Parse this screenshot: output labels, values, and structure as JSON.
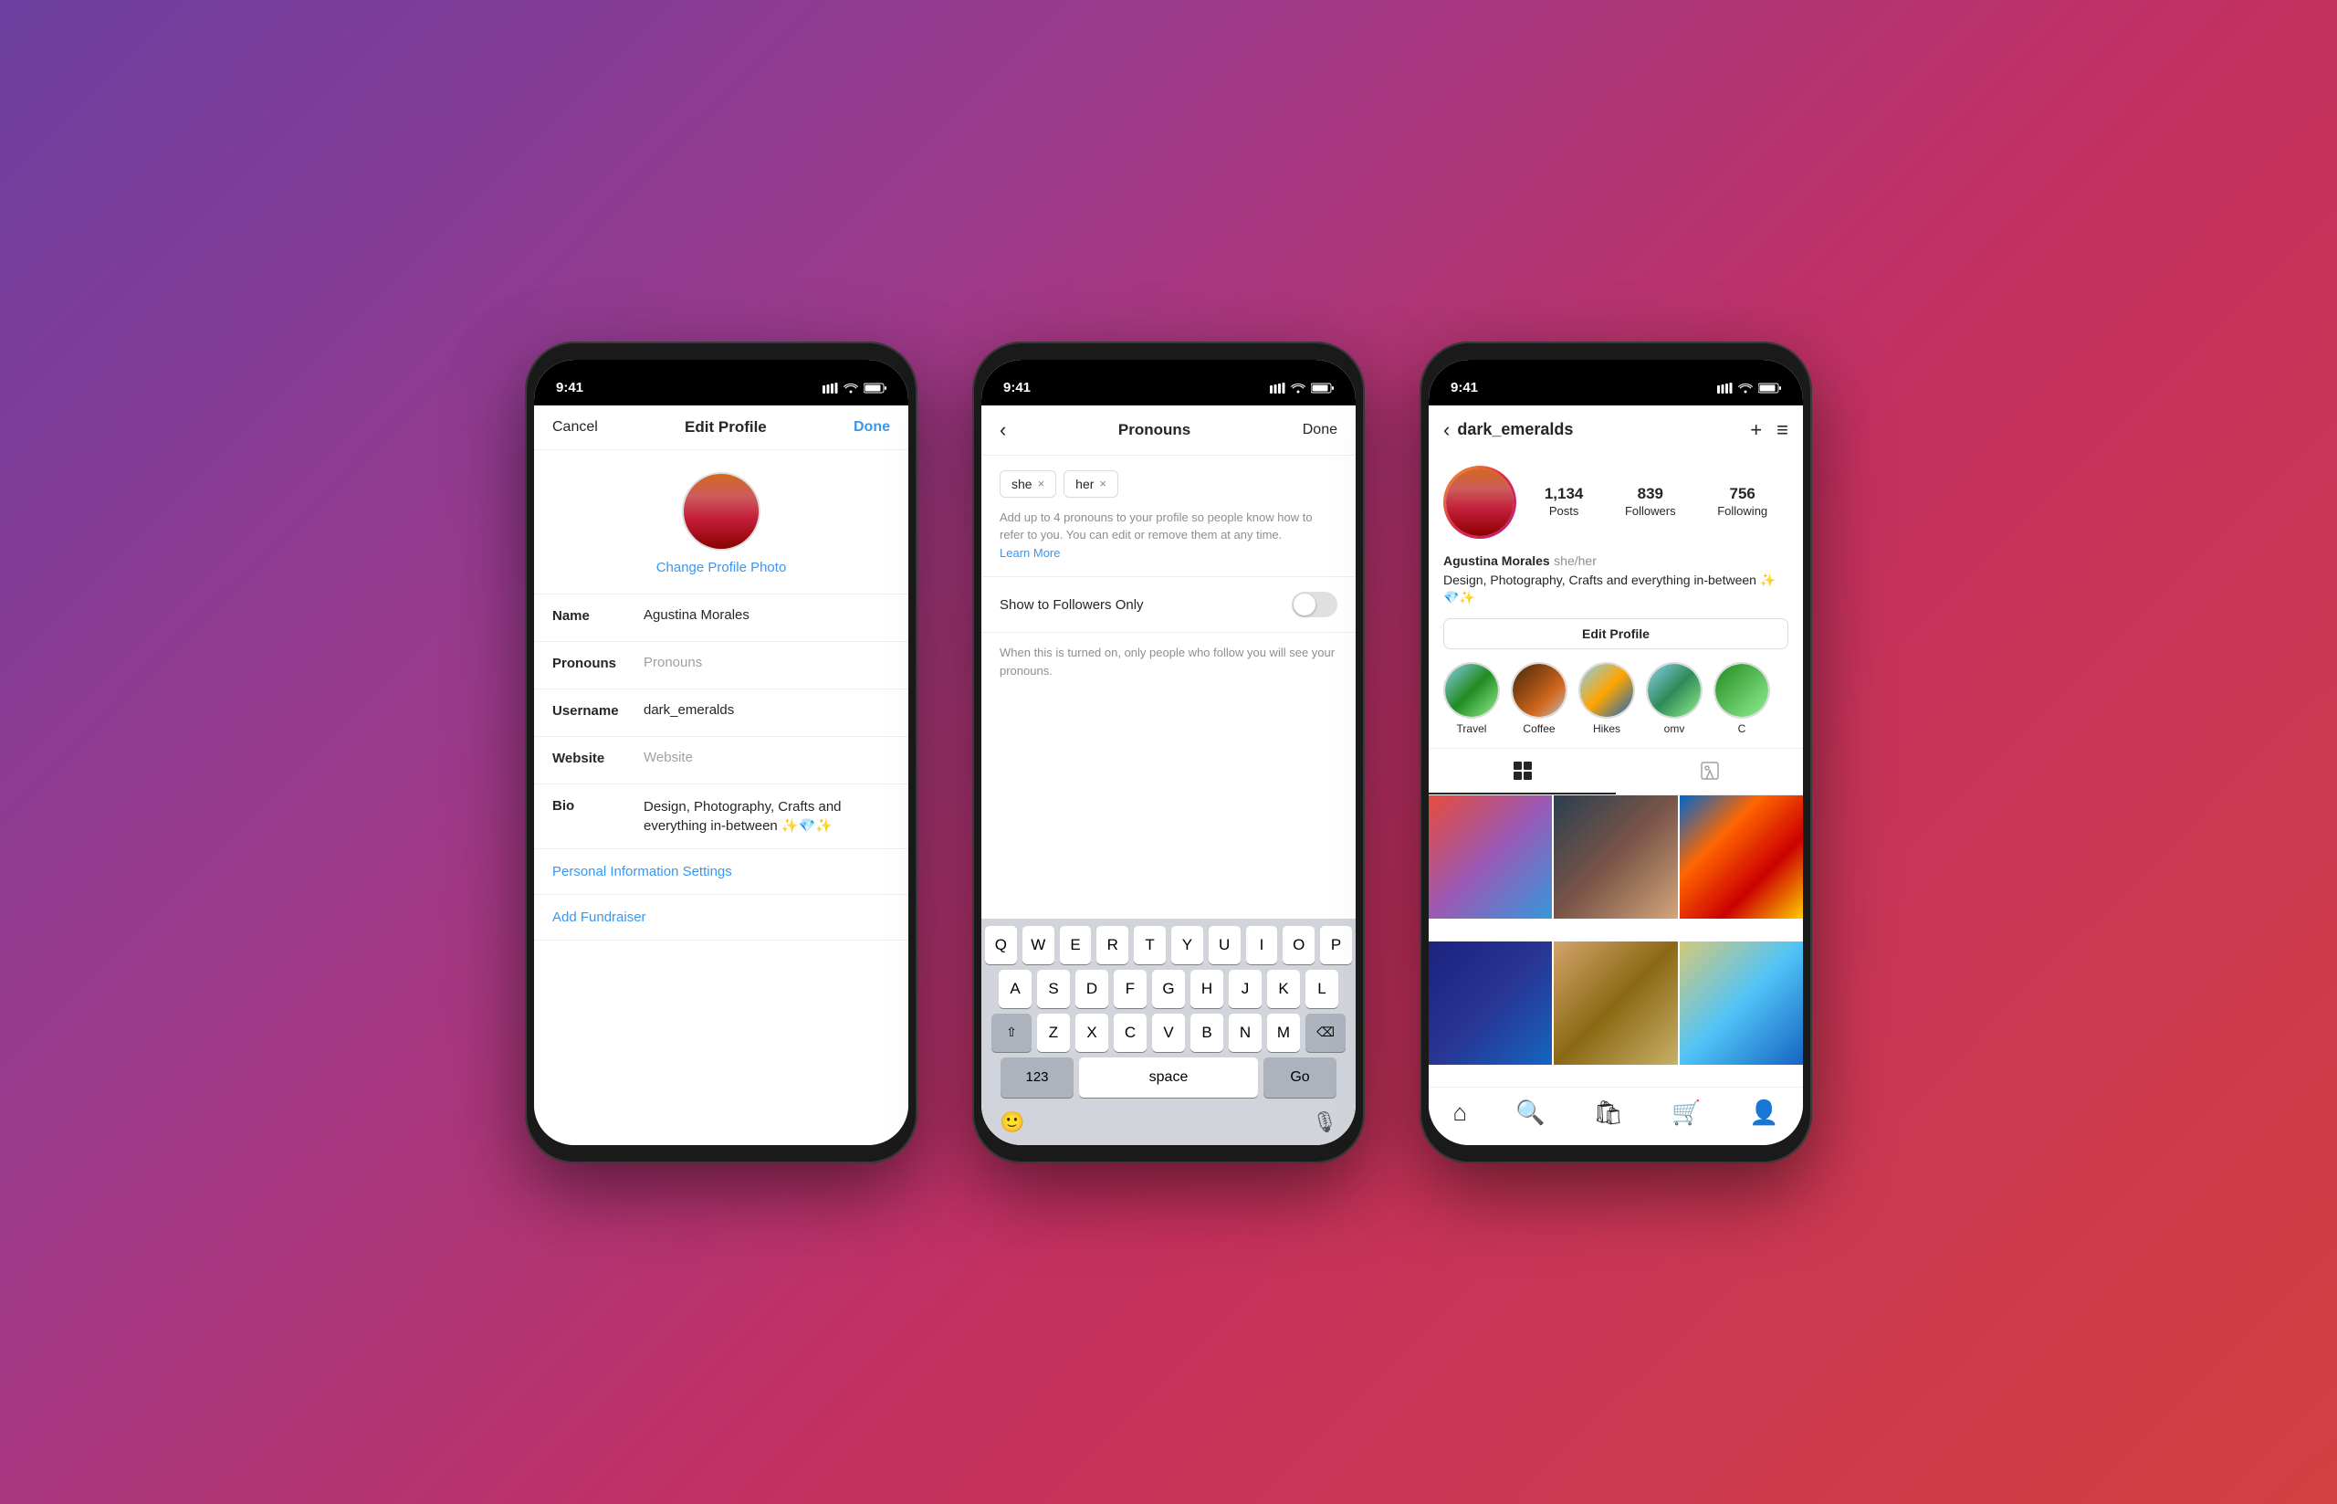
{
  "phone1": {
    "status_time": "9:41",
    "nav": {
      "cancel": "Cancel",
      "title": "Edit Profile",
      "done": "Done"
    },
    "change_photo": "Change Profile Photo",
    "fields": [
      {
        "label": "Name",
        "value": "Agustina Morales",
        "placeholder": ""
      },
      {
        "label": "Pronouns",
        "value": "",
        "placeholder": "Pronouns"
      },
      {
        "label": "Username",
        "value": "dark_emeralds",
        "placeholder": ""
      },
      {
        "label": "Website",
        "value": "",
        "placeholder": "Website"
      },
      {
        "label": "Bio",
        "value": "Design, Photography, Crafts and everything in-between ✨💎✨",
        "placeholder": ""
      }
    ],
    "personal_info_settings": "Personal Information Settings",
    "add_fundraiser": "Add Fundraiser"
  },
  "phone2": {
    "status_time": "9:41",
    "nav": {
      "back": "‹",
      "title": "Pronouns",
      "done": "Done"
    },
    "tags": [
      "she",
      "her"
    ],
    "info_text": "Add up to 4 pronouns to your profile so people know how to refer to you. You can edit or remove them at any time.",
    "learn_more": "Learn More",
    "toggle_label": "Show to Followers Only",
    "toggle_sub_text": "When this is turned on, only people who follow you will see your pronouns.",
    "keyboard": {
      "row1": [
        "Q",
        "W",
        "E",
        "R",
        "T",
        "Y",
        "U",
        "I",
        "O",
        "P"
      ],
      "row2": [
        "A",
        "S",
        "D",
        "F",
        "G",
        "H",
        "J",
        "K",
        "L"
      ],
      "row3": [
        "Z",
        "X",
        "C",
        "V",
        "B",
        "N",
        "M"
      ],
      "num_label": "123",
      "space_label": "space",
      "go_label": "Go"
    }
  },
  "phone3": {
    "status_time": "9:41",
    "nav": {
      "back": "‹",
      "username": "dark_emeralds",
      "plus": "+",
      "menu": "≡"
    },
    "stats": {
      "posts_count": "1,134",
      "posts_label": "Posts",
      "followers_count": "839",
      "followers_label": "Followers",
      "following_count": "756",
      "following_label": "Following"
    },
    "bio": {
      "name": "Agustina Morales",
      "pronouns": " she/her",
      "text": "Design, Photography, Crafts and everything in-between ✨💎✨"
    },
    "edit_profile_btn": "Edit Profile",
    "highlights": [
      {
        "label": "Travel",
        "color": "hl-travel"
      },
      {
        "label": "Coffee",
        "color": "hl-coffee"
      },
      {
        "label": "Hikes",
        "color": "hl-hikes"
      },
      {
        "label": "omv",
        "color": "hl-omv"
      },
      {
        "label": "C",
        "color": "hl-more"
      }
    ],
    "grid_photos": [
      {
        "color": "photo-colorful"
      },
      {
        "color": "photo-shadow"
      },
      {
        "color": "photo-textile"
      },
      {
        "color": "photo-blue"
      },
      {
        "color": "photo-desert"
      },
      {
        "color": "photo-sphere"
      }
    ]
  }
}
